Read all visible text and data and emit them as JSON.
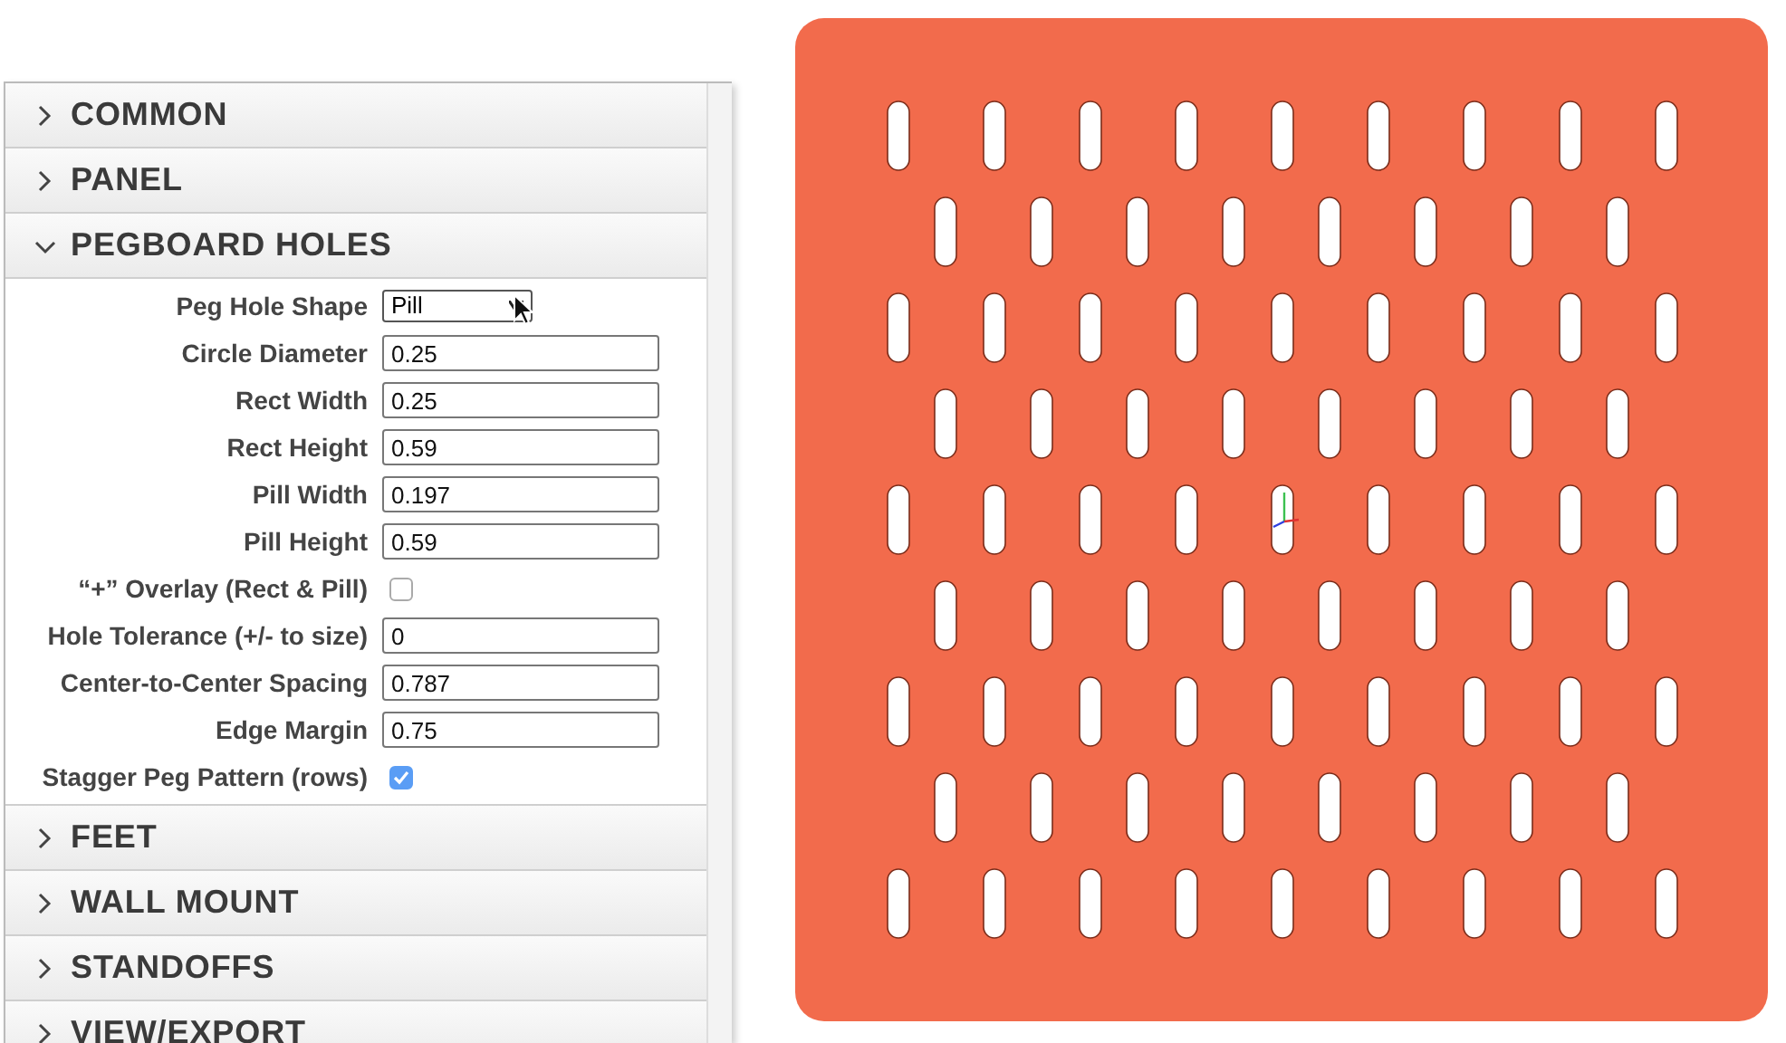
{
  "sections_before": [
    {
      "title": "COMMON",
      "expanded": false
    },
    {
      "title": "PANEL",
      "expanded": false
    }
  ],
  "open_section": {
    "title": "PEGBOARD HOLES",
    "expanded": true,
    "fields": [
      {
        "kind": "select",
        "label": "Peg Hole Shape",
        "value": "Pill"
      },
      {
        "kind": "text",
        "label": "Circle Diameter",
        "value": "0.25"
      },
      {
        "kind": "text",
        "label": "Rect Width",
        "value": "0.25"
      },
      {
        "kind": "text",
        "label": "Rect Height",
        "value": "0.59"
      },
      {
        "kind": "text",
        "label": "Pill Width",
        "value": "0.197"
      },
      {
        "kind": "text",
        "label": "Pill Height",
        "value": "0.59"
      },
      {
        "kind": "checkbox",
        "label": "“+” Overlay (Rect & Pill)",
        "checked": false
      },
      {
        "kind": "text",
        "label": "Hole Tolerance (+/- to size)",
        "value": "0"
      },
      {
        "kind": "text",
        "label": "Center-to-Center Spacing",
        "value": "0.787"
      },
      {
        "kind": "text",
        "label": "Edge Margin",
        "value": "0.75"
      },
      {
        "kind": "checkbox",
        "label": "Stagger Peg Pattern (rows)",
        "checked": true
      }
    ]
  },
  "sections_after": [
    {
      "title": "FEET",
      "expanded": false
    },
    {
      "title": "WALL MOUNT",
      "expanded": false
    },
    {
      "title": "STANDOFFS",
      "expanded": false
    },
    {
      "title": "VIEW/EXPORT",
      "expanded": false
    }
  ]
}
